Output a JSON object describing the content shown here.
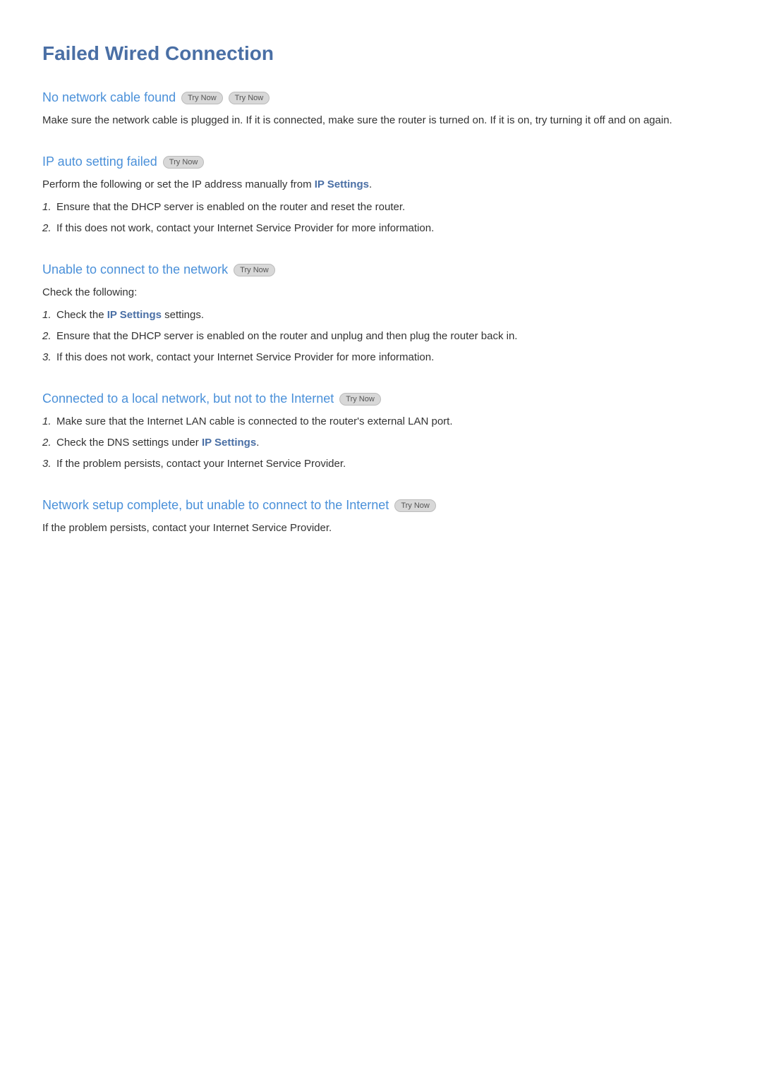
{
  "page": {
    "title": "Failed Wired Connection"
  },
  "sections": [
    {
      "id": "no-network-cable",
      "title": "No network cable found",
      "try_now_buttons": [
        "Try Now",
        "Try Now"
      ],
      "body_text": "Make sure the network cable is plugged in. If it is connected, make sure the router is turned on. If it is on, try turning it off and on again.",
      "items": []
    },
    {
      "id": "ip-auto-setting",
      "title": "IP auto setting failed",
      "try_now_buttons": [
        "Try Now"
      ],
      "intro": "Perform the following or set the IP address manually from ",
      "intro_link": "IP Settings",
      "intro_suffix": ".",
      "items": [
        "Ensure that the DHCP server is enabled on the router and reset the router.",
        "If this does not work, contact your Internet Service Provider for more information."
      ]
    },
    {
      "id": "unable-to-connect",
      "title": "Unable to connect to the network",
      "try_now_buttons": [
        "Try Now"
      ],
      "check_text": "Check the following:",
      "items": [
        {
          "text_before": "Check the ",
          "link": "IP Settings",
          "text_after": " settings."
        },
        {
          "text_before": "Ensure that the DHCP server is enabled on the router and unplug and then plug the router back in.",
          "link": "",
          "text_after": ""
        },
        {
          "text_before": "If this does not work, contact your Internet Service Provider for more information.",
          "link": "",
          "text_after": ""
        }
      ]
    },
    {
      "id": "connected-local-not-internet",
      "title": "Connected to a local network, but not to the Internet",
      "try_now_buttons": [
        "Try Now"
      ],
      "items": [
        {
          "text_before": "Make sure that the Internet LAN cable is connected to the router's external LAN port.",
          "link": "",
          "text_after": ""
        },
        {
          "text_before": "Check the DNS settings under ",
          "link": "IP Settings",
          "text_after": "."
        },
        {
          "text_before": "If the problem persists, contact your Internet Service Provider.",
          "link": "",
          "text_after": ""
        }
      ]
    },
    {
      "id": "network-setup-complete",
      "title": "Network setup complete, but unable to connect to the Internet",
      "try_now_buttons": [
        "Try Now"
      ],
      "body_text": "If the problem persists, contact your Internet Service Provider.",
      "items": []
    }
  ],
  "labels": {
    "try_now": "Try Now"
  }
}
